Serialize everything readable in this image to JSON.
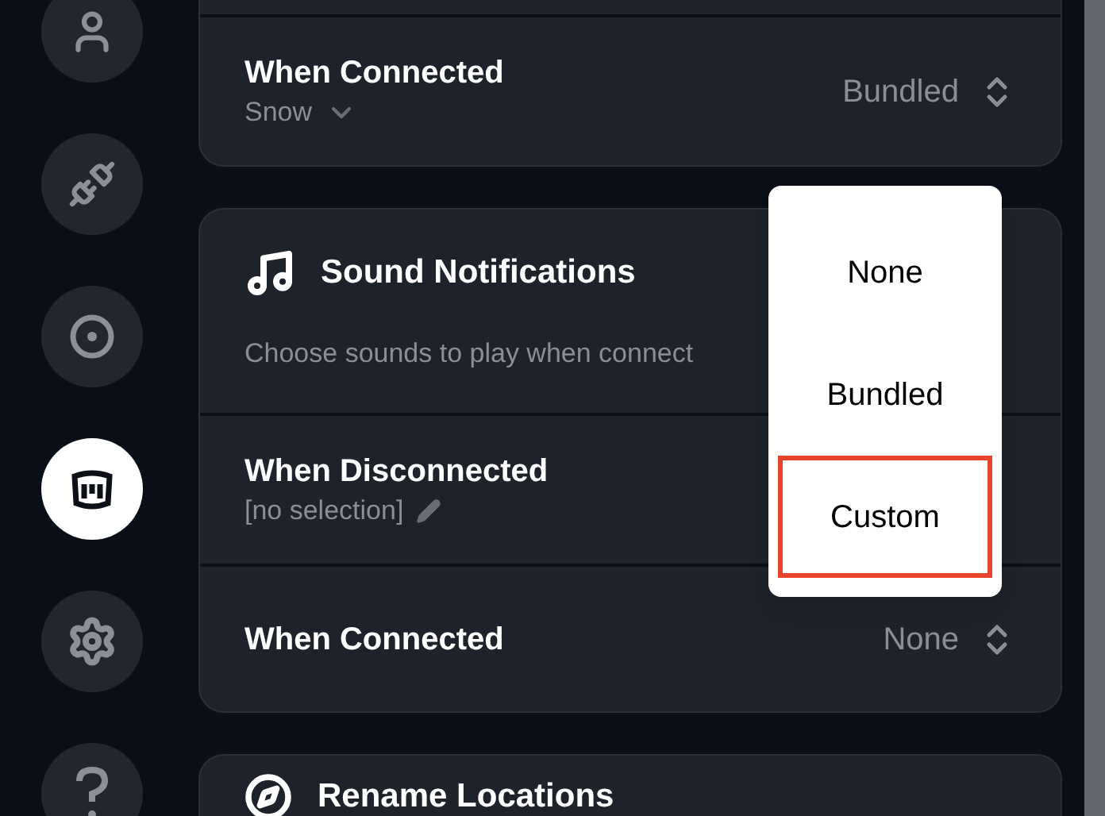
{
  "sidebar": {
    "items": [
      {
        "kind": "user",
        "selected": false
      },
      {
        "kind": "plug",
        "selected": false
      },
      {
        "kind": "target",
        "selected": false
      },
      {
        "kind": "bucket",
        "selected": true
      },
      {
        "kind": "gear",
        "selected": false
      },
      {
        "kind": "help",
        "selected": false
      }
    ]
  },
  "sections": [
    {
      "rows": [
        {
          "kind": "dropdown",
          "label": "When Connected",
          "subtitle": "Snow",
          "value": "Bundled"
        }
      ]
    },
    {
      "kind": "music",
      "title": "Sound Notifications",
      "description": "Choose sounds to play when connect",
      "rows": [
        {
          "kind": "edit",
          "label": "When Disconnected",
          "subtitle": "[no selection]"
        },
        {
          "label": "When Connected",
          "value": "None"
        }
      ]
    },
    {
      "kind": "compass",
      "title": "Rename Locations"
    }
  ],
  "menu": {
    "options": [
      {
        "label": "None",
        "selected": false
      },
      {
        "label": "Bundled",
        "selected": false
      },
      {
        "label": "Custom",
        "selected": true
      }
    ]
  }
}
